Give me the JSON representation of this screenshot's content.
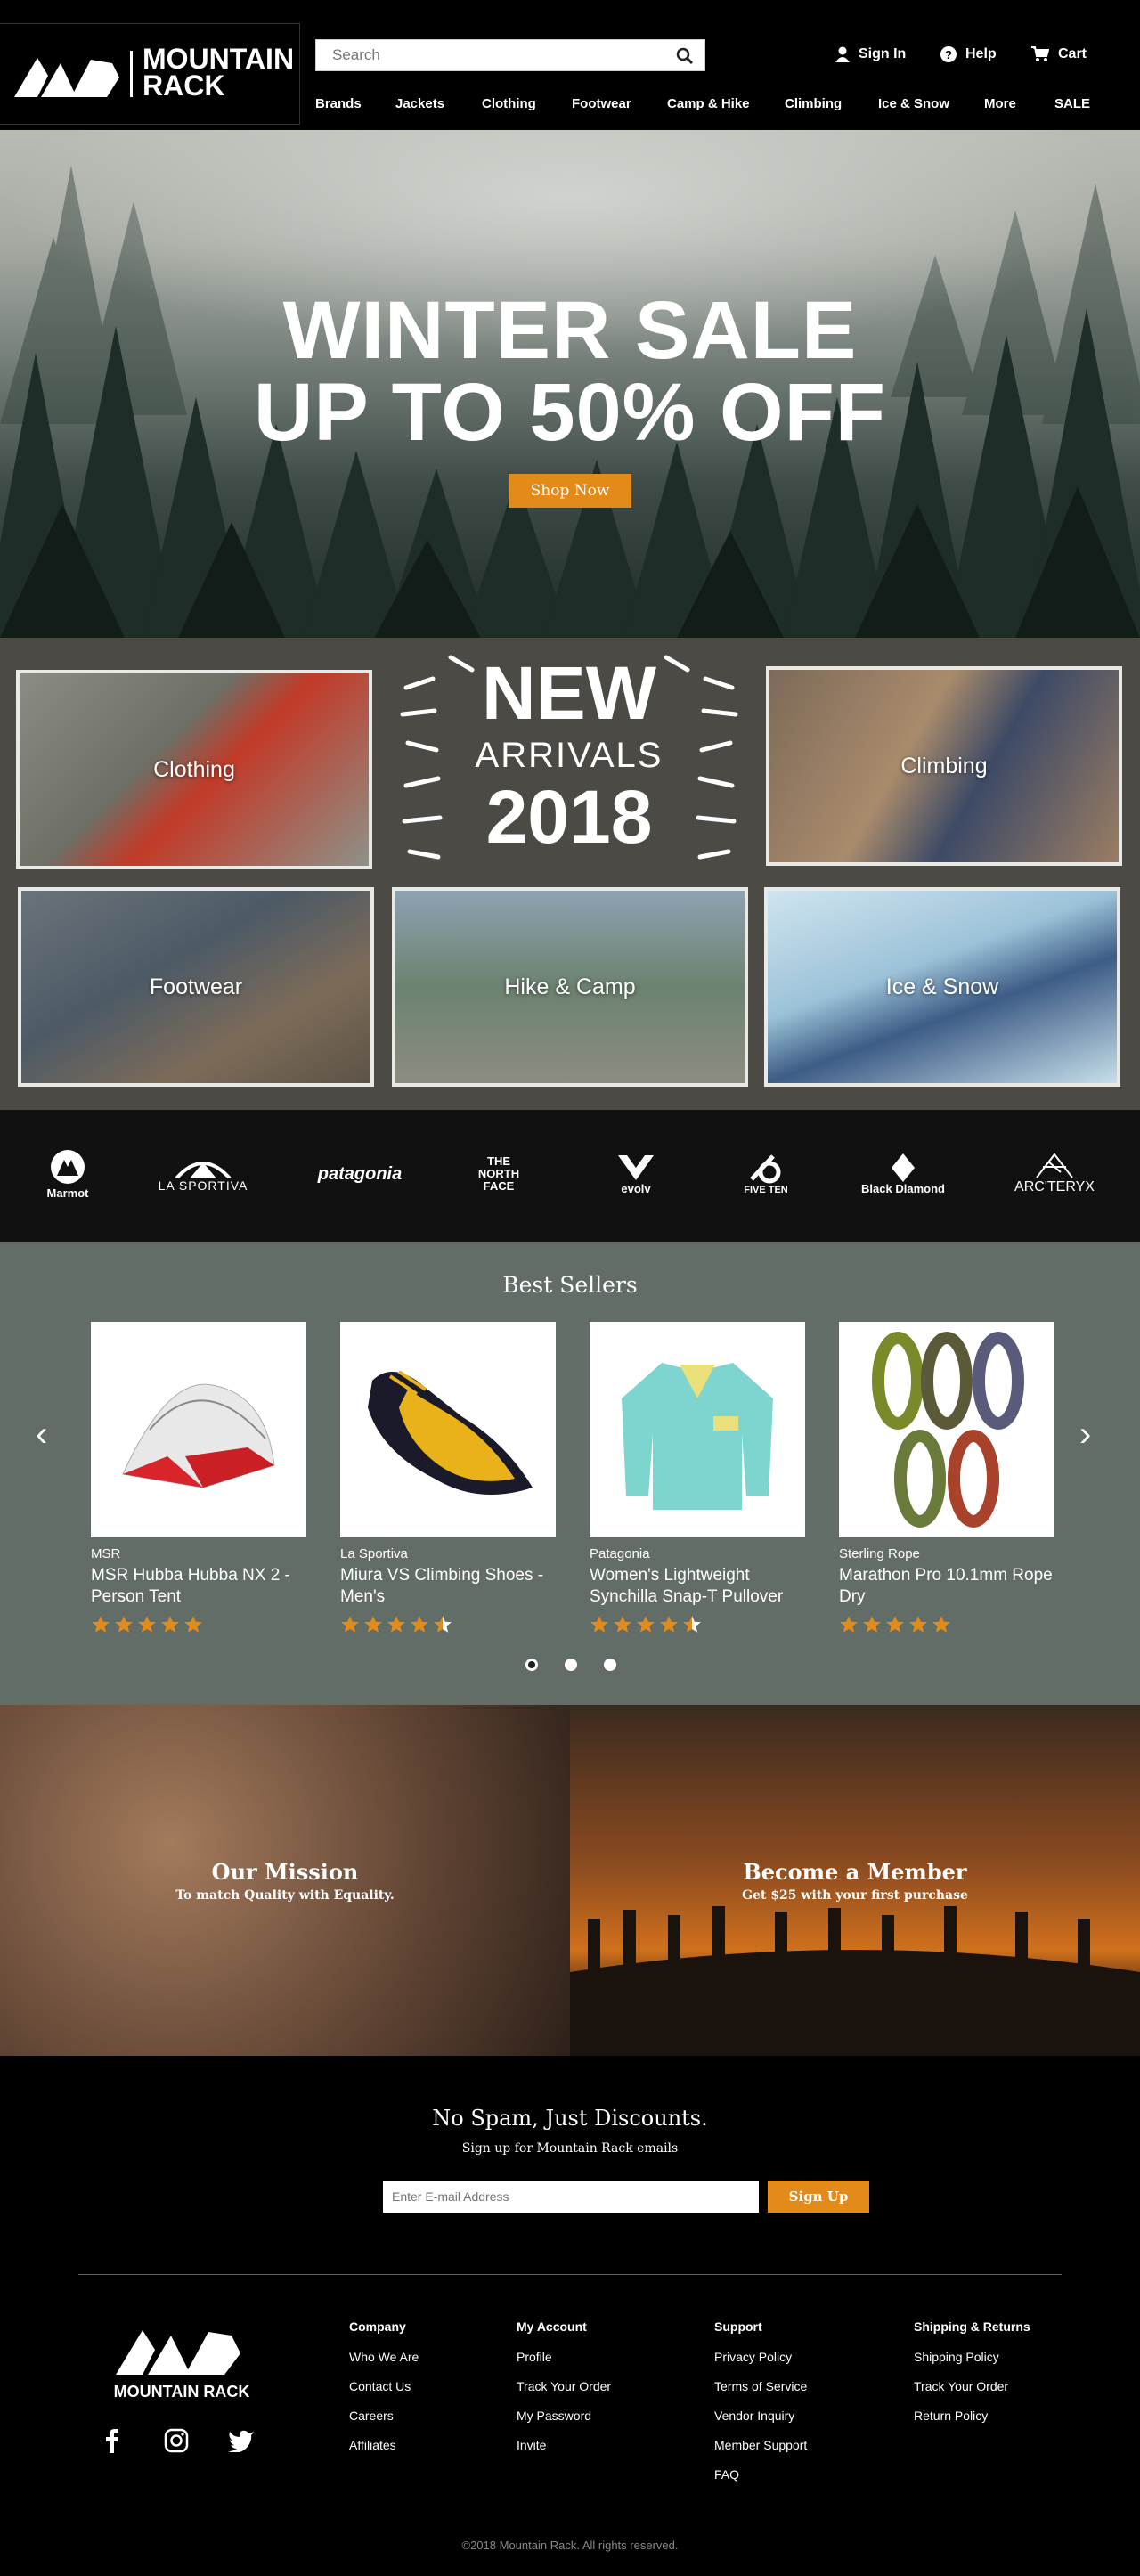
{
  "header": {
    "logo_line1": "MOUNTAIN",
    "logo_line2": "RACK",
    "search_placeholder": "Search",
    "sign_in": "Sign In",
    "help": "Help",
    "cart": "Cart",
    "nav": [
      "Brands",
      "Jackets",
      "Clothing",
      "Footwear",
      "Camp & Hike",
      "Climbing",
      "Ice & Snow",
      "More",
      "SALE"
    ]
  },
  "hero": {
    "line1": "WINTER SALE",
    "line2": "UP TO 50% OFF",
    "cta": "Shop Now"
  },
  "categories": {
    "badge_new": "NEW",
    "badge_arrivals": "ARRIVALS",
    "badge_year": "2018",
    "tiles": [
      "Clothing",
      "Climbing",
      "Footwear",
      "Hike & Camp",
      "Ice & Snow"
    ]
  },
  "brands": [
    "Marmot",
    "LA SPORTIVA",
    "patagonia",
    "THE NORTH FACE",
    "evolv",
    "FIVE TEN",
    "Black Diamond",
    "ARC'TERYX"
  ],
  "best_sellers": {
    "title": "Best Sellers",
    "products": [
      {
        "brand": "MSR",
        "name": "MSR Hubba Hubba NX 2 - Person Tent",
        "rating": 5
      },
      {
        "brand": "La Sportiva",
        "name": "Miura VS Climbing Shoes - Men's",
        "rating": 4.5
      },
      {
        "brand": "Patagonia",
        "name": "Women's Lightweight Synchilla Snap-T Pullover",
        "rating": 4.5
      },
      {
        "brand": "Sterling Rope",
        "name": "Marathon Pro 10.1mm Rope Dry",
        "rating": 5
      }
    ]
  },
  "panels": {
    "mission_title": "Our Mission",
    "mission_sub": "To match Quality with Equality.",
    "member_title": "Become a Member",
    "member_sub": "Get $25 with your first purchase"
  },
  "newsletter": {
    "title": "No Spam, Just Discounts.",
    "subtitle": "Sign up for Mountain Rack emails",
    "placeholder": "Enter E-mail Address",
    "button": "Sign Up"
  },
  "footer": {
    "logo_text": "MOUNTAIN RACK",
    "columns": [
      {
        "title": "Company",
        "links": [
          "Who We Are",
          "Contact Us",
          "Careers",
          "Affiliates"
        ]
      },
      {
        "title": "My Account",
        "links": [
          "Profile",
          "Track Your Order",
          "My Password",
          "Invite"
        ]
      },
      {
        "title": "Support",
        "links": [
          "Privacy Policy",
          "Terms of Service",
          "Vendor Inquiry",
          "Member Support",
          "FAQ"
        ]
      },
      {
        "title": "Shipping & Returns",
        "links": [
          "Shipping Policy",
          "Track Your Order",
          "Return Policy"
        ]
      }
    ],
    "copyright": "©2018 Mountain Rack. All rights reserved."
  },
  "colors": {
    "accent": "#e28a1a",
    "star": "#e28a1a",
    "panel_gray": "#4b4a45",
    "best_bg": "#626d67"
  }
}
